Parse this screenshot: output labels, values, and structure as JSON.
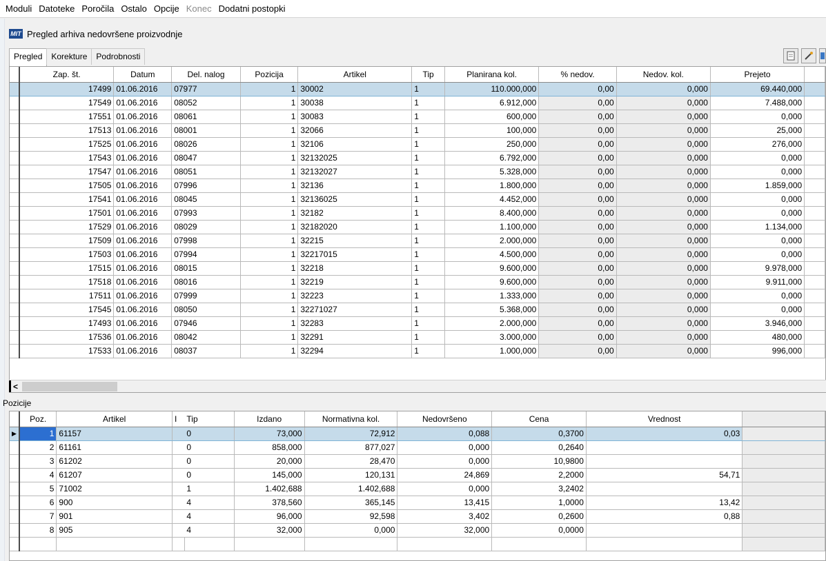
{
  "menu": [
    "Moduli",
    "Datoteke",
    "Poročila",
    "Ostalo",
    "Opcije",
    "Konec",
    "Dodatni postopki"
  ],
  "menu_disabled_index": 5,
  "window": {
    "logo": "MIT",
    "title": "Pregled arhiva nedovršene proizvodnje"
  },
  "tabs": [
    "Pregled",
    "Korekture",
    "Podrobnosti"
  ],
  "main_table": {
    "columns": [
      "Zap. št.",
      "Datum",
      "Del. nalog",
      "Pozicija",
      "Artikel",
      "Tip",
      "Planirana kol.",
      "% nedov.",
      "Nedov. kol.",
      "Prejeto"
    ],
    "rows": [
      [
        "17499",
        "01.06.2016",
        "07977",
        "1",
        "30002",
        "1",
        "110.000,000",
        "0,00",
        "0,000",
        "69.440,000"
      ],
      [
        "17549",
        "01.06.2016",
        "08052",
        "1",
        "30038",
        "1",
        "6.912,000",
        "0,00",
        "0,000",
        "7.488,000"
      ],
      [
        "17551",
        "01.06.2016",
        "08061",
        "1",
        "30083",
        "1",
        "600,000",
        "0,00",
        "0,000",
        "0,000"
      ],
      [
        "17513",
        "01.06.2016",
        "08001",
        "1",
        "32066",
        "1",
        "100,000",
        "0,00",
        "0,000",
        "25,000"
      ],
      [
        "17525",
        "01.06.2016",
        "08026",
        "1",
        "32106",
        "1",
        "250,000",
        "0,00",
        "0,000",
        "276,000"
      ],
      [
        "17543",
        "01.06.2016",
        "08047",
        "1",
        "32132025",
        "1",
        "6.792,000",
        "0,00",
        "0,000",
        "0,000"
      ],
      [
        "17547",
        "01.06.2016",
        "08051",
        "1",
        "32132027",
        "1",
        "5.328,000",
        "0,00",
        "0,000",
        "0,000"
      ],
      [
        "17505",
        "01.06.2016",
        "07996",
        "1",
        "32136",
        "1",
        "1.800,000",
        "0,00",
        "0,000",
        "1.859,000"
      ],
      [
        "17541",
        "01.06.2016",
        "08045",
        "1",
        "32136025",
        "1",
        "4.452,000",
        "0,00",
        "0,000",
        "0,000"
      ],
      [
        "17501",
        "01.06.2016",
        "07993",
        "1",
        "32182",
        "1",
        "8.400,000",
        "0,00",
        "0,000",
        "0,000"
      ],
      [
        "17529",
        "01.06.2016",
        "08029",
        "1",
        "32182020",
        "1",
        "1.100,000",
        "0,00",
        "0,000",
        "1.134,000"
      ],
      [
        "17509",
        "01.06.2016",
        "07998",
        "1",
        "32215",
        "1",
        "2.000,000",
        "0,00",
        "0,000",
        "0,000"
      ],
      [
        "17503",
        "01.06.2016",
        "07994",
        "1",
        "32217015",
        "1",
        "4.500,000",
        "0,00",
        "0,000",
        "0,000"
      ],
      [
        "17515",
        "01.06.2016",
        "08015",
        "1",
        "32218",
        "1",
        "9.600,000",
        "0,00",
        "0,000",
        "9.978,000"
      ],
      [
        "17518",
        "01.06.2016",
        "08016",
        "1",
        "32219",
        "1",
        "9.600,000",
        "0,00",
        "0,000",
        "9.911,000"
      ],
      [
        "17511",
        "01.06.2016",
        "07999",
        "1",
        "32223",
        "1",
        "1.333,000",
        "0,00",
        "0,000",
        "0,000"
      ],
      [
        "17545",
        "01.06.2016",
        "08050",
        "1",
        "32271027",
        "1",
        "5.368,000",
        "0,00",
        "0,000",
        "0,000"
      ],
      [
        "17493",
        "01.06.2016",
        "07946",
        "1",
        "32283",
        "1",
        "2.000,000",
        "0,00",
        "0,000",
        "3.946,000"
      ],
      [
        "17536",
        "01.06.2016",
        "08042",
        "1",
        "32291",
        "1",
        "3.000,000",
        "0,00",
        "0,000",
        "480,000"
      ],
      [
        "17533",
        "01.06.2016",
        "08037",
        "1",
        "32294",
        "1",
        "1.000,000",
        "0,00",
        "0,000",
        "996,000"
      ]
    ],
    "selected_row": 0
  },
  "scroll_left_symbol": "<",
  "positions_label": "Pozicije",
  "positions_table": {
    "columns": [
      "Poz.",
      "Artikel",
      "I",
      "Tip",
      "Izdano",
      "Normativna kol.",
      "Nedovršeno",
      "Cena",
      "Vrednost"
    ],
    "rows": [
      [
        "1",
        "61157",
        "0",
        "73,000",
        "72,912",
        "0,088",
        "0,3700",
        "0,03"
      ],
      [
        "2",
        "61161",
        "0",
        "858,000",
        "877,027",
        "0,000",
        "0,2640",
        ""
      ],
      [
        "3",
        "61202",
        "0",
        "20,000",
        "28,470",
        "0,000",
        "10,9800",
        ""
      ],
      [
        "4",
        "61207",
        "0",
        "145,000",
        "120,131",
        "24,869",
        "2,2000",
        "54,71"
      ],
      [
        "5",
        "71002",
        "1",
        "1.402,688",
        "1.402,688",
        "0,000",
        "3,2402",
        ""
      ],
      [
        "6",
        "900",
        "4",
        "378,560",
        "365,145",
        "13,415",
        "1,0000",
        "13,42"
      ],
      [
        "7",
        "901",
        "4",
        "96,000",
        "92,598",
        "3,402",
        "0,2600",
        "0,88"
      ],
      [
        "8",
        "905",
        "4",
        "32,000",
        "0,000",
        "32,000",
        "0,0000",
        ""
      ]
    ],
    "selected_row": 0,
    "row_pointer": "▶"
  },
  "colors": {
    "selection": "#c5dbea",
    "current_cell": "#2c6fd1",
    "logo_bg": "#1e4a8f"
  }
}
